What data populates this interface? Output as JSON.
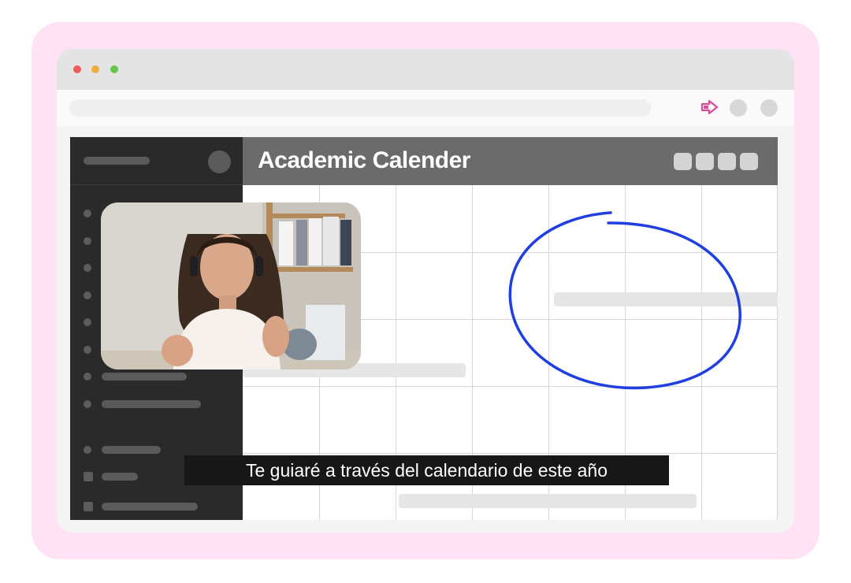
{
  "app": {
    "title": "Academic Calender"
  },
  "caption": {
    "text": "Te guiaré a través del calendario de este año"
  },
  "video": {
    "subject": "presenter webcam feed"
  },
  "icons": {
    "extension": "share-arrow-icon"
  },
  "colors": {
    "frame": "#ffe2f3",
    "sidebar": "#2a2a2a",
    "header": "#6b6b6b",
    "annotation_circle": "#1f3fe0",
    "extension_icon": "#e0489a"
  }
}
